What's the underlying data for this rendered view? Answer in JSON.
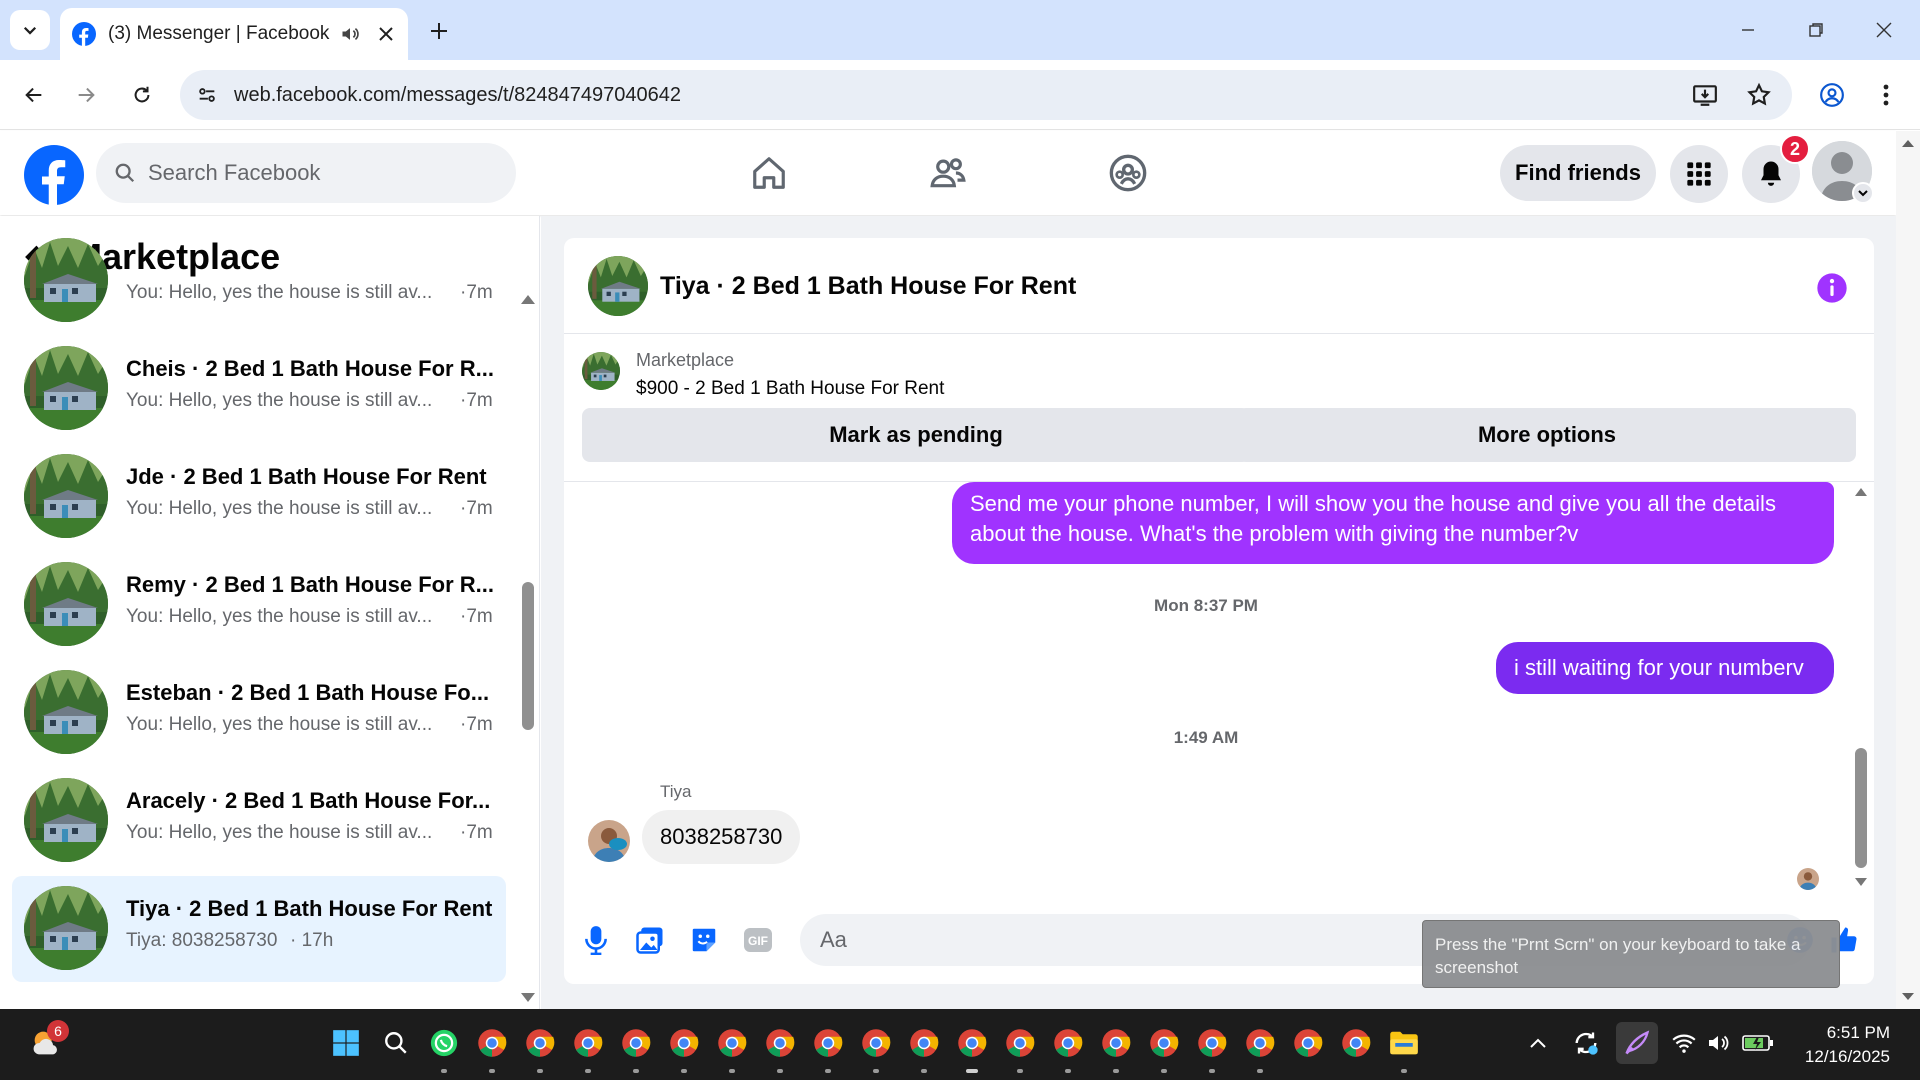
{
  "browser": {
    "tab_title": "(3) Messenger | Facebook",
    "url": "web.facebook.com/messages/t/824847497040642"
  },
  "fb": {
    "search_placeholder": "Search Facebook",
    "find_friends": "Find friends",
    "notification_count": "2"
  },
  "sidebar": {
    "title": "Marketplace",
    "conversations": [
      {
        "name": "",
        "snippet": "You: Hello, yes the house is still av...",
        "time": "·7m"
      },
      {
        "name": "Cheis · 2 Bed 1 Bath House For R...",
        "snippet": "You: Hello, yes the house is still av...",
        "time": "·7m"
      },
      {
        "name": "Jde · 2 Bed 1 Bath House For Rent",
        "snippet": "You: Hello, yes the house is still av...",
        "time": "·7m"
      },
      {
        "name": "Remy · 2 Bed 1 Bath House For R...",
        "snippet": "You: Hello, yes the house is still av...",
        "time": "·7m"
      },
      {
        "name": "Esteban · 2 Bed 1 Bath House Fo...",
        "snippet": "You: Hello, yes the house is still av...",
        "time": "·7m"
      },
      {
        "name": "Aracely · 2 Bed 1 Bath House For...",
        "snippet": "You: Hello, yes the house is still av...",
        "time": "·7m"
      },
      {
        "name": "Tiya · 2 Bed 1 Bath House For Rent",
        "snippet": "Tiya: 8038258730",
        "time": "· 17h"
      }
    ]
  },
  "chat": {
    "title": "Tiya · 2 Bed 1 Bath House For Rent",
    "listing_label": "Marketplace",
    "listing_price": "$900 - 2 Bed 1 Bath House For Rent",
    "mark_pending": "Mark as pending",
    "more_options": "More options",
    "messages": {
      "sent1": "Send me your phone number, I will show you the house and give you all the details about the house. What's the problem with giving the number?v",
      "ts1": "Mon 8:37 PM",
      "sent2": "i still waiting for your numberv",
      "ts2": "1:49 AM",
      "sender": "Tiya",
      "received": "8038258730"
    },
    "input_placeholder": "Aa"
  },
  "tooltip": "Press the \"Prnt Scrn\" on your keyboard to take a screenshot",
  "taskbar": {
    "weather_badge": "6",
    "time": "6:51 PM",
    "date": "12/16/2025"
  },
  "colors": {
    "fb_blue": "#0866ff",
    "bubble_purple": "#a033ff",
    "bubble_violet": "#7b2bf0",
    "active_row": "#e7f3ff"
  }
}
